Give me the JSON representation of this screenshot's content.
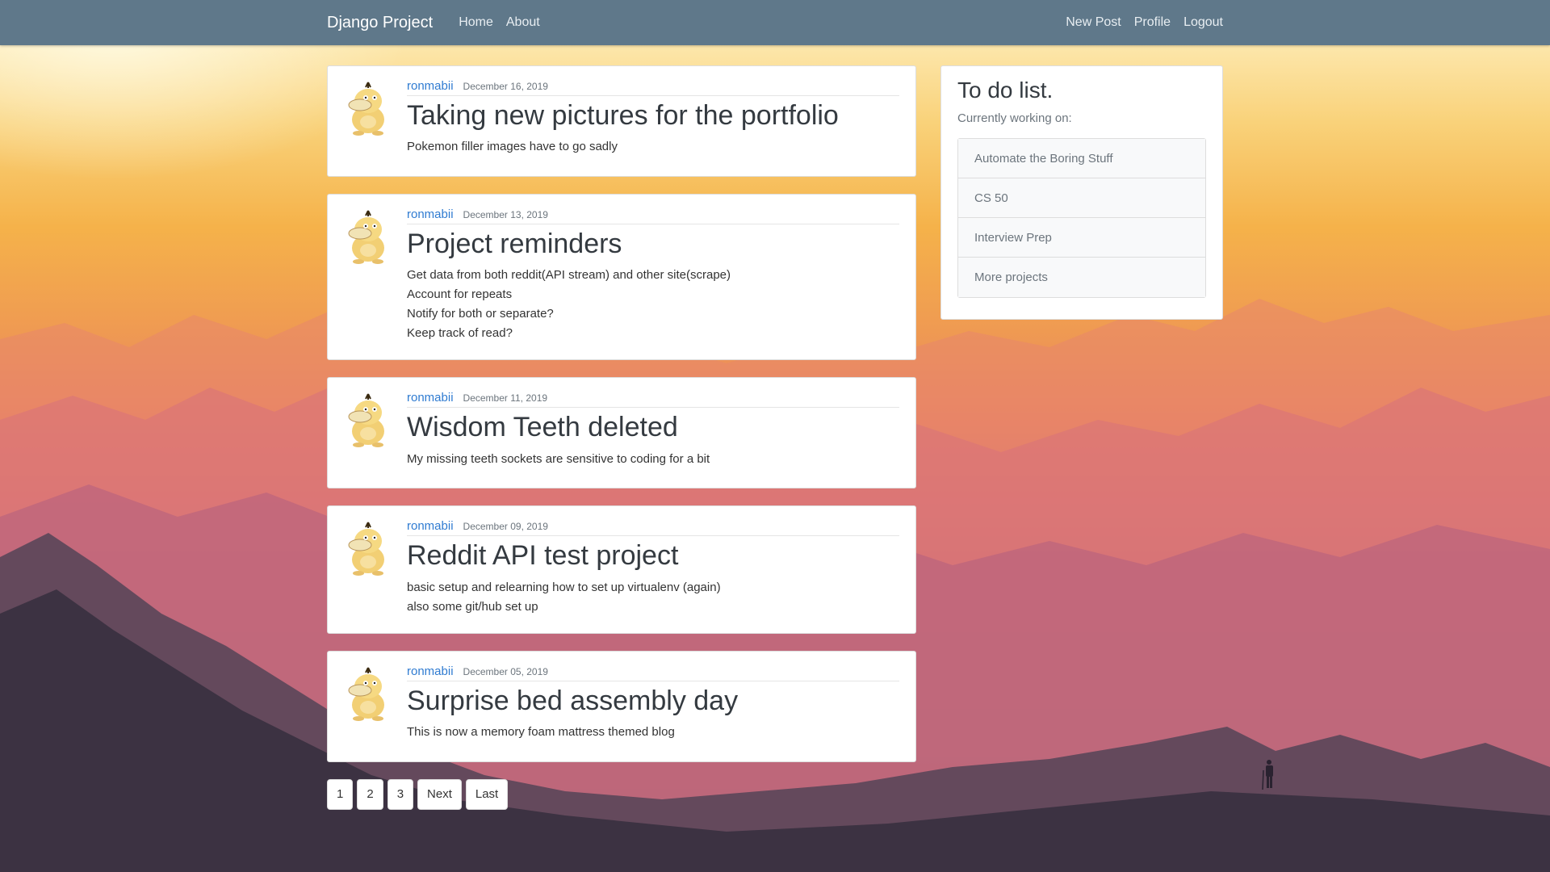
{
  "navbar": {
    "brand": "Django Project",
    "links": [
      "Home",
      "About"
    ],
    "right_links": [
      "New Post",
      "Profile",
      "Logout"
    ]
  },
  "posts": [
    {
      "author": "ronmabii",
      "date": "December 16, 2019",
      "title": "Taking new pictures for the portfolio",
      "lines": [
        "Pokemon filler images have to go sadly"
      ]
    },
    {
      "author": "ronmabii",
      "date": "December 13, 2019",
      "title": "Project reminders",
      "lines": [
        "Get data from both reddit(API stream) and other site(scrape)",
        "Account for repeats",
        "Notify for both or separate?",
        "Keep track of read?"
      ]
    },
    {
      "author": "ronmabii",
      "date": "December 11, 2019",
      "title": "Wisdom Teeth deleted",
      "lines": [
        "My missing teeth sockets are sensitive to coding for a bit"
      ]
    },
    {
      "author": "ronmabii",
      "date": "December 09, 2019",
      "title": "Reddit API test project",
      "lines": [
        "basic setup and relearning how to set up virtualenv (again)",
        "also some git/hub set up"
      ]
    },
    {
      "author": "ronmabii",
      "date": "December 05, 2019",
      "title": "Surprise bed assembly day",
      "lines": [
        "This is now a memory foam mattress themed blog"
      ]
    }
  ],
  "pagination": [
    "1",
    "2",
    "3",
    "Next",
    "Last"
  ],
  "sidebar": {
    "title": "To do list.",
    "subtitle": "Currently working on:",
    "items": [
      "Automate the Boring Stuff",
      "CS 50",
      "Interview Prep",
      "More projects"
    ]
  },
  "icons": {
    "avatar": "psyduck-avatar-icon"
  },
  "colors": {
    "navbar": "#5f788a",
    "author_link": "#2f7bd1"
  }
}
